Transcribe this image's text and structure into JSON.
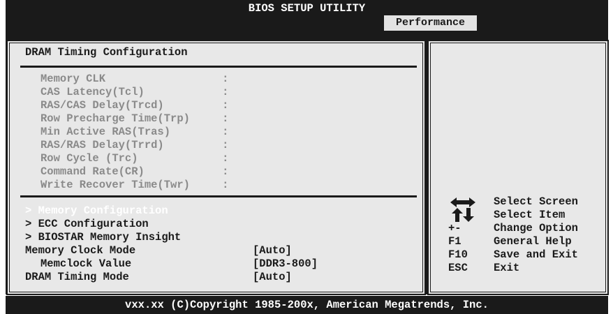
{
  "header": {
    "title": "BIOS SETUP UTILITY",
    "active_tab": "Performance"
  },
  "section_title": "DRAM Timing Configuration",
  "timing_items": [
    {
      "label": "Memory CLK",
      "sep": ":"
    },
    {
      "label": "CAS Latency(Tcl)",
      "sep": ":"
    },
    {
      "label": "RAS/CAS Delay(Trcd)",
      "sep": ":"
    },
    {
      "label": "Row Precharge Time(Trp)",
      "sep": ":"
    },
    {
      "label": "Min Active RAS(Tras)",
      "sep": ":"
    },
    {
      "label": "RAS/RAS Delay(Trrd)",
      "sep": ":"
    },
    {
      "label": "Row Cycle (Trc)",
      "sep": ":"
    },
    {
      "label": "Command Rate(CR)",
      "sep": ":"
    },
    {
      "label": "Write Recover Time(Twr)",
      "sep": ":"
    }
  ],
  "submenus": [
    {
      "label": "> Memory Configuration"
    },
    {
      "label": "> ECC Configuration"
    },
    {
      "label": "> BIOSTAR Memory Insight"
    }
  ],
  "settings": [
    {
      "label": "Memory Clock Mode",
      "value": "[Auto]"
    },
    {
      "label": "Memclock Value",
      "value": "[DDR3-800]"
    },
    {
      "label": "DRAM Timing Mode",
      "value": "[Auto]"
    }
  ],
  "help": [
    {
      "key_icon": "left-right-arrows-icon",
      "desc": "Select Screen"
    },
    {
      "key_icon": "up-down-arrows-icon",
      "desc": "Select Item"
    },
    {
      "key": "+-",
      "desc": "Change Option"
    },
    {
      "key": "F1",
      "desc": "General Help"
    },
    {
      "key": "F10",
      "desc": "Save and Exit"
    },
    {
      "key": "ESC",
      "desc": "Exit"
    }
  ],
  "footer": "vxx.xx (C)Copyright 1985-200x, American Megatrends, Inc.",
  "colors": {
    "background": "#e8e8e8",
    "frame": "#1a1a1a",
    "disabled_text": "#8a8a8a",
    "highlight_text": "#ffffff"
  }
}
